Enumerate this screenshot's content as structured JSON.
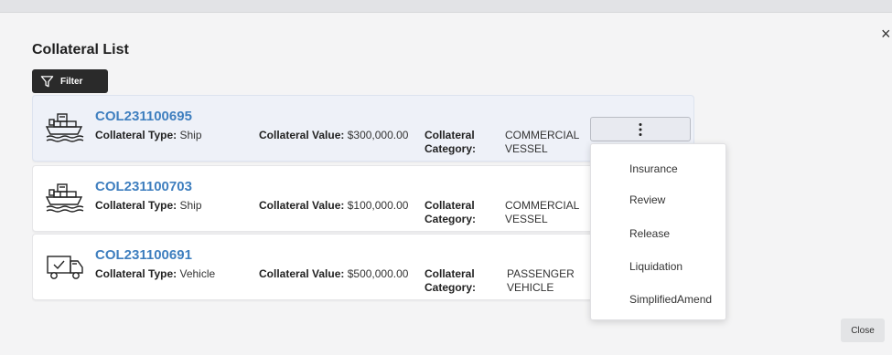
{
  "dialog": {
    "title": "Collateral List",
    "filter_label": "Filter",
    "close_label": "Close",
    "close_icon": "×"
  },
  "labels": {
    "type_label": "Collateral Type:",
    "value_label": "Collateral Value:",
    "category_label_line1": "Collateral",
    "category_label_line2": "Category:"
  },
  "collaterals": [
    {
      "id": "COL231100695",
      "icon": "ship-icon",
      "type": "Ship",
      "value": "$300,000.00",
      "category_line1": "COMMERCIAL",
      "category_line2": "VESSEL"
    },
    {
      "id": "COL231100703",
      "icon": "ship-icon",
      "type": "Ship",
      "value": "$100,000.00",
      "category_line1": "COMMERCIAL",
      "category_line2": "VESSEL"
    },
    {
      "id": "COL231100691",
      "icon": "truck-icon",
      "type": "Vehicle",
      "value": "$500,000.00",
      "category_line1": "PASSENGER",
      "category_line2": "VEHICLE"
    }
  ],
  "actions_menu": [
    "Insurance",
    "Review",
    "Release",
    "Liquidation",
    "SimplifiedAmend"
  ],
  "colors": {
    "link": "#3f7fbf",
    "dark_button": "#2a2a2a",
    "selected_card": "#eef1f8"
  }
}
